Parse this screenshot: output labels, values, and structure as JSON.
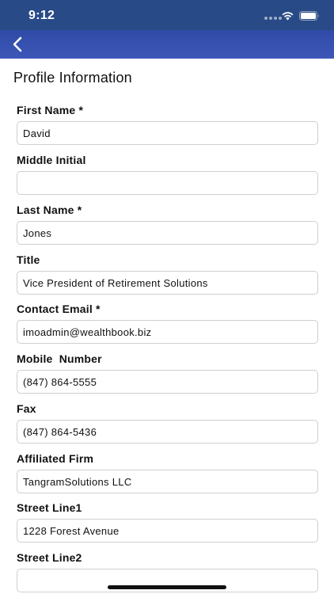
{
  "status_bar": {
    "time": "9:12"
  },
  "nav_bar": {
    "back_icon": "chevron-left-icon"
  },
  "page": {
    "section_title": "Profile Information"
  },
  "fields": [
    {
      "label": "First Name *",
      "value": "David"
    },
    {
      "label": "Middle Initial",
      "value": ""
    },
    {
      "label": "Last Name *",
      "value": "Jones"
    },
    {
      "label": "Title",
      "value": "Vice President of Retirement Solutions"
    },
    {
      "label": "Contact Email *",
      "value": "imoadmin@wealthbook.biz"
    },
    {
      "label": "Mobile  Number",
      "value": "(847) 864-5555"
    },
    {
      "label": "Fax",
      "value": "(847) 864-5436"
    },
    {
      "label": "Affiliated Firm",
      "value": "TangramSolutions LLC"
    },
    {
      "label": "Street Line1",
      "value": "1228 Forest Avenue"
    },
    {
      "label": "Street Line2",
      "value": ""
    }
  ],
  "colors": {
    "status_bar": "#284a86",
    "nav_bar": "#3350ae",
    "input_border": "#cfcfcf"
  }
}
